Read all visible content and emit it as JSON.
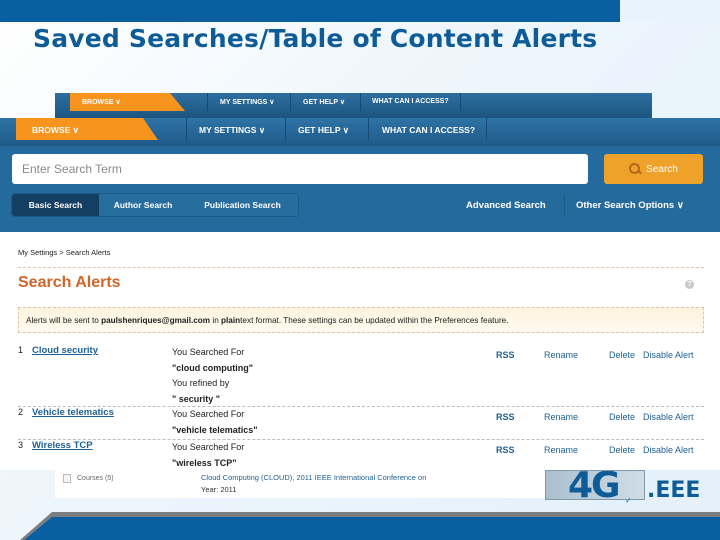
{
  "slide": {
    "title": "Saved Searches/Table of Content Alerts"
  },
  "nav_back": {
    "items": [
      "BROWSE ∨",
      "MY SETTINGS ∨",
      "GET HELP ∨",
      "WHAT CAN I ACCESS?"
    ]
  },
  "nav": {
    "browse": "BROWSE ∨",
    "my_settings": "MY SETTINGS ∨",
    "get_help": "GET HELP ∨",
    "what_can_i_access": "WHAT CAN I ACCESS?"
  },
  "search": {
    "placeholder": "Enter Search Term",
    "value": "",
    "button_label": "Search",
    "tabs": [
      "Basic Search",
      "Author Search",
      "Publication Search"
    ],
    "active_tab": "Basic Search",
    "advanced_label": "Advanced Search",
    "other_options_label": "Other Search Options ∨"
  },
  "content": {
    "breadcrumb": "My Settings > Search Alerts",
    "heading": "Search Alerts",
    "help_icon": "?",
    "notice": {
      "prefix": "Alerts will be sent to ",
      "email": "paulshenriques@gmail.com",
      "middle": " in ",
      "format": "plain",
      "suffix": "text format. These settings can be updated within the Preferences feature."
    },
    "alerts": [
      {
        "num": "1",
        "name": "Cloud security",
        "searched_label": "You Searched For",
        "query": "\"cloud computing\"",
        "refined_label": "You refined by",
        "refinement": "\" security \"",
        "actions": [
          "RSS",
          "Rename",
          "Delete",
          "Disable Alert"
        ]
      },
      {
        "num": "2",
        "name": "Vehicle telematics",
        "searched_label": "You Searched For",
        "query": "\"vehicle telematics\"",
        "actions": [
          "RSS",
          "Rename",
          "Delete",
          "Disable Alert"
        ]
      },
      {
        "num": "3",
        "name": "Wireless TCP",
        "searched_label": "You Searched For",
        "query": "\"wireless TCP\"",
        "actions": [
          "RSS",
          "Rename",
          "Delete",
          "Disable Alert"
        ]
      }
    ]
  },
  "background_result": {
    "facet": "Courses (5)",
    "title": "Cloud Computing (CLOUD), 2011 IEEE International Conference on",
    "year": "Year: 2011"
  },
  "logo": {
    "mark": "4G",
    "text": ".EEE"
  },
  "colors": {
    "brand_blue": "#0a5fa0",
    "nav_orange": "#f7941d",
    "search_button": "#eea22a",
    "heading_orange": "#d2652a",
    "link_blue": "#1e5f93"
  }
}
